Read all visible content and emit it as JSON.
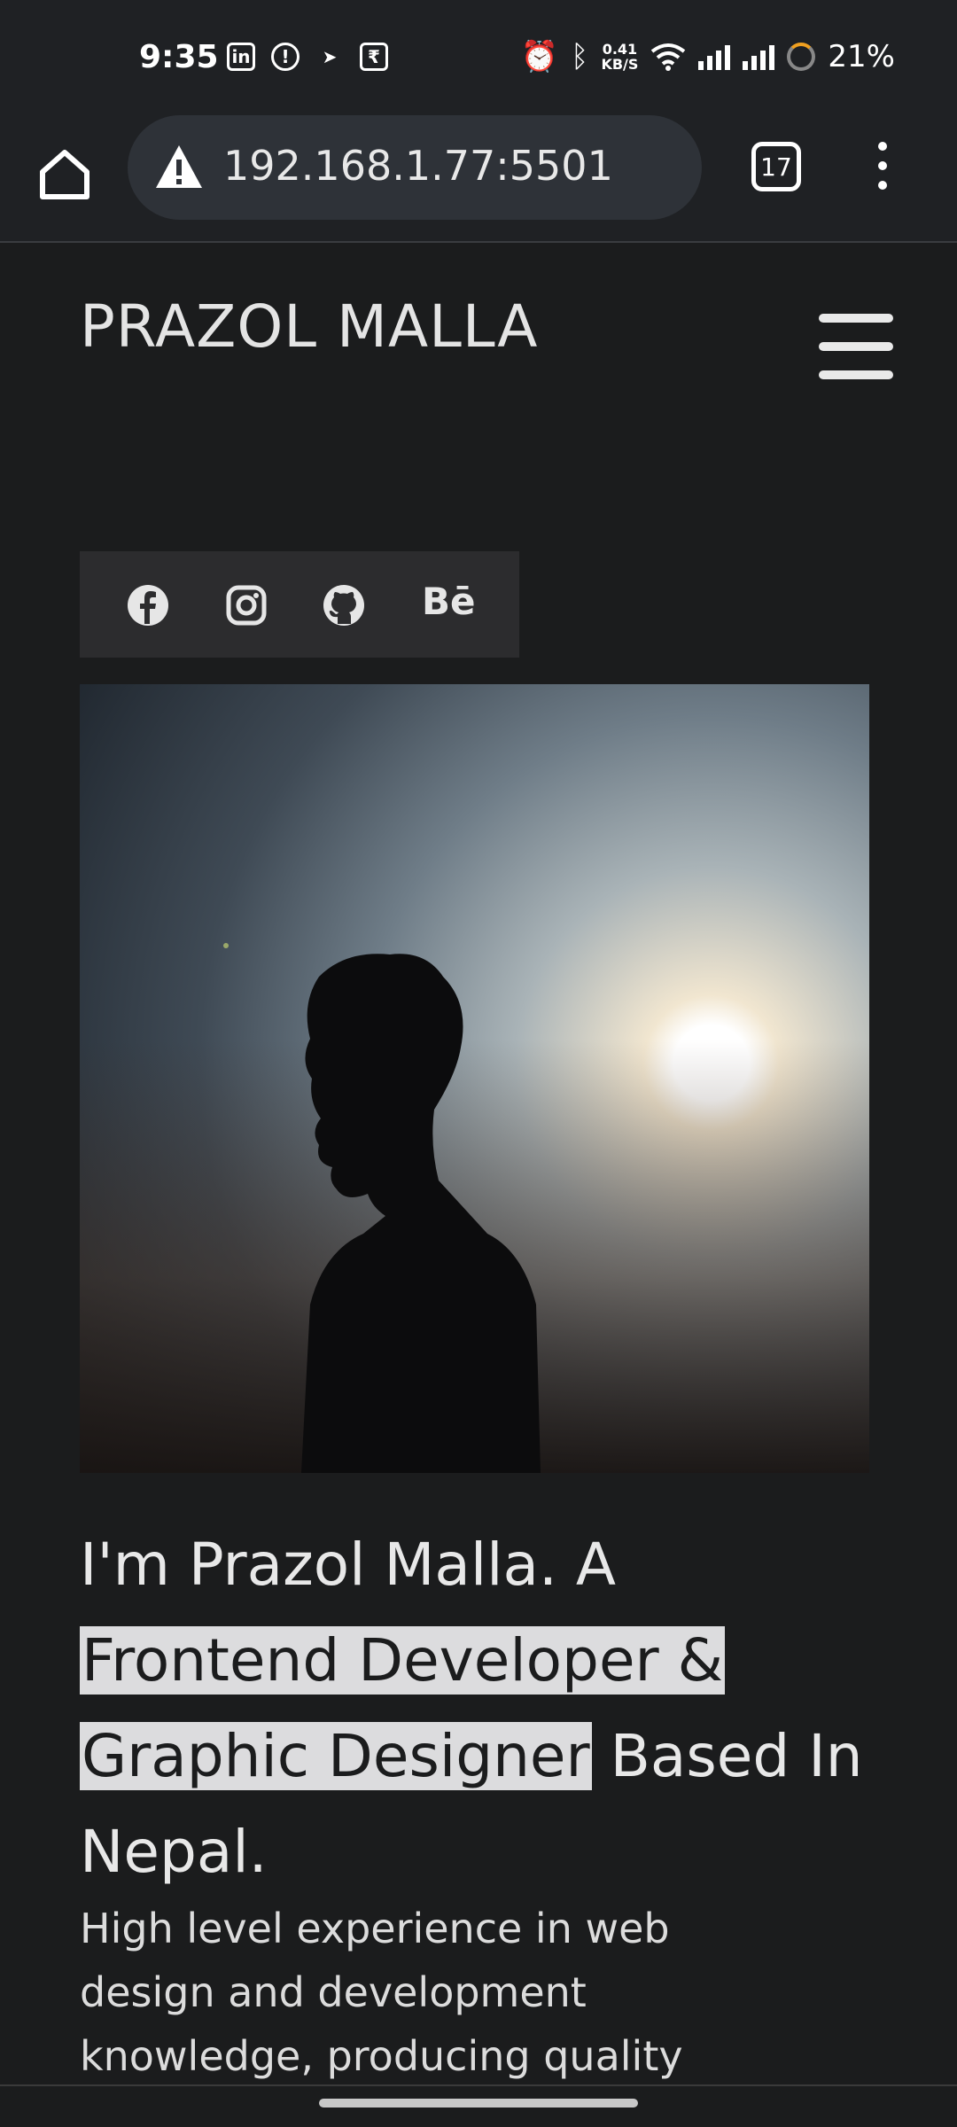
{
  "status_bar": {
    "time": "9:35",
    "left_icons": [
      "linkedin-icon",
      "notification-icon",
      "app-icon",
      "payment-icon"
    ],
    "network_speed_value": "0.41",
    "network_speed_unit": "KB/S",
    "battery": "21%"
  },
  "browser": {
    "url": "192.168.1.77:5501",
    "tab_count": "17"
  },
  "site": {
    "brand": "PRAZOL MALLA",
    "social_links": [
      "facebook-icon",
      "instagram-icon",
      "github-icon",
      "behance-icon"
    ],
    "behance_label": "Bē",
    "headline_intro": "I'm Prazol Malla. A ",
    "headline_highlight_1": "Frontend Developer &",
    "headline_highlight_2": "Graphic Designer",
    "headline_outro": " Based In Nepal.",
    "subtext": "High level experience in web design and development knowledge, producing quality"
  }
}
